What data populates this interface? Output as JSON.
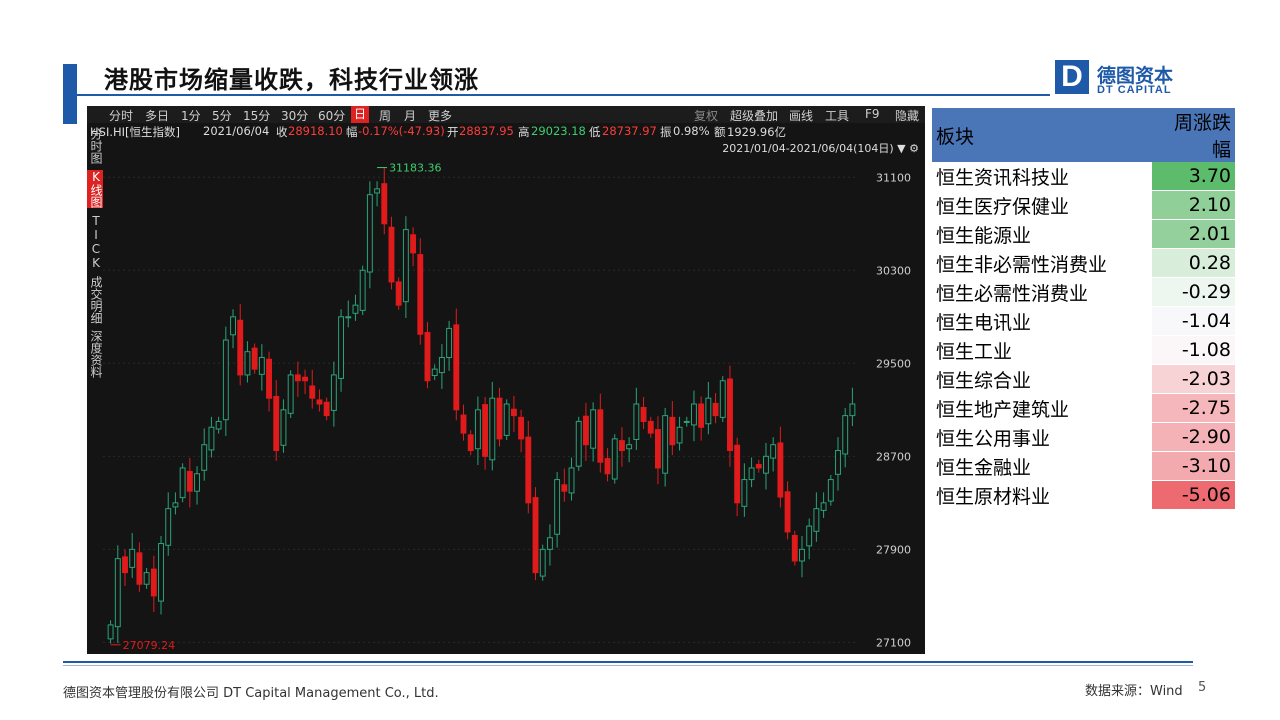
{
  "title": "港股市场缩量收跌，科技行业领涨",
  "logo": {
    "mark": "D",
    "cn": "德图资本",
    "en": "DT CAPITAL"
  },
  "toolbar": {
    "left": [
      "分时",
      "多日",
      "1分",
      "5分",
      "15分",
      "30分",
      "60分",
      "日",
      "周",
      "月",
      "更多"
    ],
    "active": "日",
    "right": [
      "复权",
      "超级叠加",
      "画线",
      "工具",
      "F9",
      "隐藏"
    ]
  },
  "info": {
    "ticker": "HSI.HI[恒生指数]",
    "date": "2021/06/04",
    "close_label": "收",
    "close": "28918.10",
    "change_label": "幅",
    "change": "-0.17%(-47.93)",
    "open_label": "开",
    "open": "28837.95",
    "high_label": "高",
    "high": "29023.18",
    "low_label": "低",
    "low": "28737.97",
    "amp_label": "振",
    "amp": "0.98%",
    "amount_label": "额",
    "amount": "1929.96亿",
    "range": "2021/01/04-2021/06/04(104日)"
  },
  "sidebar": [
    {
      "label": "分时图",
      "active": false
    },
    {
      "label": "K线图",
      "active": true
    },
    {
      "label": "TICK",
      "active": false
    },
    {
      "label": "成交明细",
      "active": false
    },
    {
      "label": "深度资料",
      "active": false
    }
  ],
  "chart_data": {
    "type": "candlestick",
    "title": "HSI.HI[恒生指数]",
    "ylim": [
      27000,
      31300
    ],
    "yticks": [
      "31100",
      "30300",
      "29500",
      "28700",
      "27900",
      "27100"
    ],
    "max_label": "31183.36",
    "min_label": "27079.24",
    "up_color": "#2aa378",
    "down_color": "#e01b1b",
    "closes": [
      27250,
      27820,
      27700,
      27900,
      27600,
      27700,
      27500,
      27950,
      28250,
      28300,
      28600,
      28400,
      28550,
      28800,
      28950,
      29000,
      29700,
      29900,
      29400,
      29600,
      29450,
      29550,
      29200,
      28750,
      29100,
      29400,
      29350,
      29350,
      29200,
      29150,
      29050,
      29400,
      29900,
      29900,
      30000,
      30300,
      30950,
      31000,
      30700,
      30200,
      30000,
      30650,
      30450,
      29750,
      29350,
      29450,
      29550,
      29800,
      29100,
      28900,
      28750,
      29100,
      28700,
      29200,
      28850,
      29150,
      29050,
      28850,
      28300,
      27700,
      27900,
      28000,
      28500,
      28400,
      28600,
      29000,
      28800,
      29100,
      28650,
      28550,
      28850,
      28750,
      28800,
      29150,
      29000,
      28900,
      28600,
      29050,
      28800,
      28950,
      29000,
      29150,
      28950,
      29200,
      29050,
      29350,
      28750,
      28300,
      28500,
      28600,
      28600,
      28700,
      28800,
      28350,
      28050,
      27800,
      27900,
      28100,
      28250,
      28300,
      28500,
      28750,
      29050,
      29150
    ]
  },
  "table": {
    "headers": [
      "板块",
      "周涨跌幅"
    ],
    "rows": [
      {
        "name": "恒生资讯科技业",
        "value": "3.70",
        "color": "#5dbb6c"
      },
      {
        "name": "恒生医疗保健业",
        "value": "2.10",
        "color": "#90cf98"
      },
      {
        "name": "恒生能源业",
        "value": "2.01",
        "color": "#94d09b"
      },
      {
        "name": "恒生非必需性消费业",
        "value": "0.28",
        "color": "#d8eedb"
      },
      {
        "name": "恒生必需性消费业",
        "value": "-0.29",
        "color": "#eef6f0"
      },
      {
        "name": "恒生电讯业",
        "value": "-1.04",
        "color": "#f8f8fa"
      },
      {
        "name": "恒生工业",
        "value": "-1.08",
        "color": "#fbf6f7"
      },
      {
        "name": "恒生综合业",
        "value": "-2.03",
        "color": "#f8d3d6"
      },
      {
        "name": "恒生地产建筑业",
        "value": "-2.75",
        "color": "#f5b7bb"
      },
      {
        "name": "恒生公用事业",
        "value": "-2.90",
        "color": "#f4b2b6"
      },
      {
        "name": "恒生金融业",
        "value": "-3.10",
        "color": "#f3aaaf"
      },
      {
        "name": "恒生原材料业",
        "value": "-5.06",
        "color": "#ec6a70"
      }
    ]
  },
  "footer": {
    "company": "德图资本管理股份有限公司 DT Capital Management Co., Ltd.",
    "source": "数据来源：Wind",
    "page": "5"
  }
}
